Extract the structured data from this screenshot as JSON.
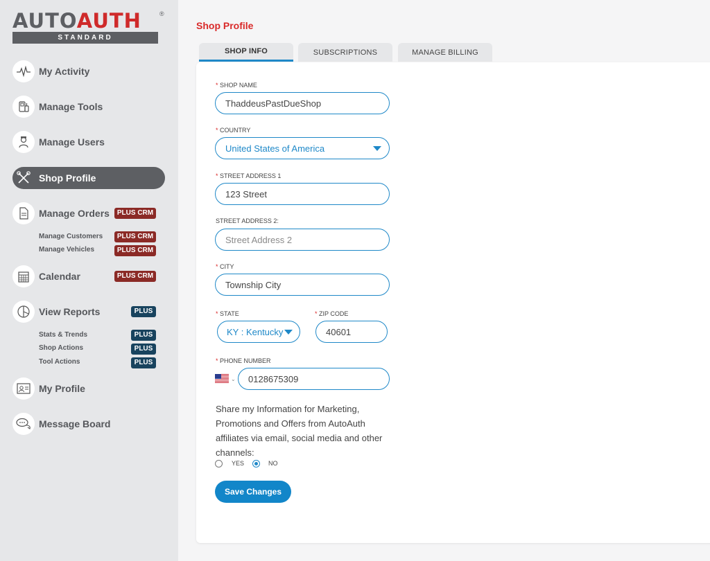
{
  "logo": {
    "part1": "AUTO",
    "part2": "AUTH",
    "reg": "®",
    "edition": "STANDARD"
  },
  "colors": {
    "accent": "#1e88c8",
    "brand_red": "#d92a2a",
    "crm_badge": "#8b2a26",
    "plus_badge": "#18435e",
    "sidebar_bg": "#e6e7e9"
  },
  "sidebar": {
    "items": [
      {
        "label": "My Activity",
        "icon": "activity-icon"
      },
      {
        "label": "Manage Tools",
        "icon": "tools-icon"
      },
      {
        "label": "Manage Users",
        "icon": "users-icon"
      },
      {
        "label": "Shop Profile",
        "icon": "wrench-icon",
        "active": true
      },
      {
        "label": "Manage Orders",
        "icon": "orders-icon",
        "badge": "PLUS CRM"
      },
      {
        "label": "Calendar",
        "icon": "calendar-icon",
        "badge": "PLUS CRM"
      },
      {
        "label": "View Reports",
        "icon": "pie-chart-icon",
        "badge": "PLUS"
      },
      {
        "label": "My Profile",
        "icon": "profile-card-icon"
      },
      {
        "label": "Message Board",
        "icon": "chat-icon"
      }
    ],
    "orders_sub": [
      {
        "label": "Manage Customers",
        "badge": "PLUS CRM"
      },
      {
        "label": "Manage Vehicles",
        "badge": "PLUS CRM"
      }
    ],
    "reports_sub": [
      {
        "label": "Stats & Trends",
        "badge": "PLUS"
      },
      {
        "label": "Shop Actions",
        "badge": "PLUS"
      },
      {
        "label": "Tool Actions",
        "badge": "PLUS"
      }
    ]
  },
  "page_title": "Shop Profile",
  "tabs": [
    {
      "label": "SHOP INFO",
      "active": true
    },
    {
      "label": "SUBSCRIPTIONS"
    },
    {
      "label": "MANAGE BILLING"
    }
  ],
  "form": {
    "required_mark": "*",
    "shop_name": {
      "label": "SHOP NAME",
      "value": "ThaddeusPastDueShop"
    },
    "country": {
      "label": "COUNTRY",
      "value": "United States of America"
    },
    "street1": {
      "label": "STREET ADDRESS 1",
      "value": "123 Street"
    },
    "street2": {
      "label": "STREET ADDRESS 2:",
      "value": "",
      "placeholder": "Street Address 2"
    },
    "city": {
      "label": "CITY",
      "value": "Township City"
    },
    "state": {
      "label": "STATE",
      "value": "KY : Kentucky"
    },
    "zip": {
      "label": "ZIP CODE",
      "value": "40601"
    },
    "phone": {
      "label": "PHONE NUMBER",
      "value": "0128675309",
      "country_flag": "us-flag-icon"
    },
    "share_text": "Share my Information for Marketing, Promotions and Offers from AutoAuth affiliates via email, social media and other channels:",
    "share_options": [
      {
        "label": "YES",
        "checked": false
      },
      {
        "label": "NO",
        "checked": true
      }
    ],
    "save_label": "Save Changes"
  }
}
